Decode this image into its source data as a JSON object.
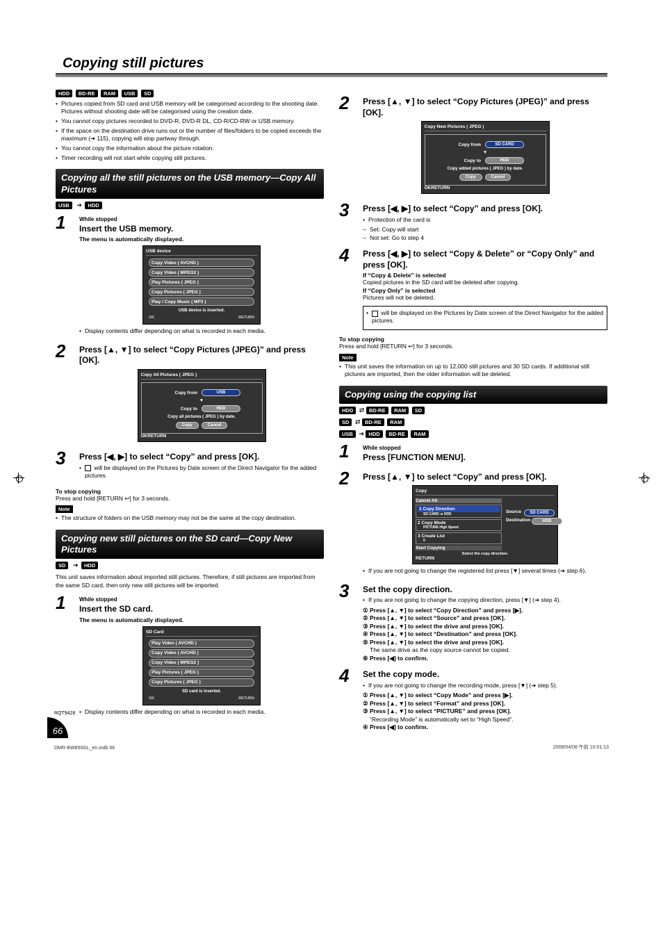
{
  "title": "Copying still pictures",
  "top_tags": [
    "HDD",
    "BD-RE",
    "RAM",
    "USB",
    "SD"
  ],
  "intro": [
    "Pictures copied from SD card and USB memory will be categorised according to the shooting date. Pictures without shooting date will be categorised using the creation date.",
    "You cannot copy pictures recorded to DVD-R, DVD-R DL, CD-R/CD-RW or USB memory.",
    "If the space on the destination drive runs out or the number of files/folders to be copied exceeds the maximum (➔ 115), copying will stop partway through.",
    "You cannot copy the information about the picture rotation.",
    "Timer recording will not start while copying still pictures."
  ],
  "sec1": {
    "head": "Copying all the still pictures on the USB memory—Copy All Pictures",
    "arrow_from": "USB",
    "arrow_to": "HDD",
    "step1_kicker": "While stopped",
    "step1_main": "Insert the USB memory.",
    "step1_sub": "The menu is automatically displayed.",
    "usb_panel": {
      "title": "USB device",
      "items": [
        "Copy Video ( AVCHD )",
        "Copy Video ( MPEG2 )",
        "Play Pictures ( JPEG )",
        "Copy Pictures ( JPEG )",
        "Play / Copy Music ( MP3 )"
      ],
      "msg": "USB device is inserted.",
      "ok": "OK",
      "ret": "RETURN"
    },
    "step1_foot": "Display contents differ depending on what is recorded in each media.",
    "step2_main": "Press [▲, ▼] to select “Copy Pictures (JPEG)” and press [OK].",
    "copyall_panel": {
      "title": "Copy All Pictures ( JPEG )",
      "from_lbl": "Copy from",
      "from_val": "USB",
      "to_lbl": "Copy to",
      "to_val": "HDD",
      "note": "Copy all pictures ( JPEG ) by date.",
      "btn1": "Copy",
      "btn2": "Cancel",
      "ok": "OK",
      "ret": "RETURN"
    },
    "step3_main": "Press [◀, ▶] to select “Copy” and press [OK].",
    "step3_foot": " will be displayed on the Pictures by Date screen of the Direct Navigator for the added pictures.",
    "stop_head": "To stop copying",
    "stop_body": "Press and hold [RETURN ↩] for 3 seconds.",
    "note_lbl": "Note",
    "note_body": "The structure of folders on the USB memory may not be the same at the copy destination."
  },
  "sec2": {
    "head": "Copying new still pictures on the SD card—Copy New Pictures",
    "arrow_from": "SD",
    "arrow_to": "HDD",
    "intro": "This unit saves information about imported still pictures. Therefore, if still pictures are imported from the same SD card, then only new still pictures will be imported.",
    "step1_kicker": "While stopped",
    "step1_main": "Insert the SD card.",
    "step1_sub": "The menu is automatically displayed.",
    "sd_panel": {
      "title": "SD Card",
      "items": [
        "Play Video ( AVCHD )",
        "Copy Video ( AVCHD )",
        "Copy Video ( MPEG2 )",
        "Play Pictures ( JPEG )",
        "Copy Pictures ( JPEG )"
      ],
      "msg": "SD card is inserted.",
      "ok": "OK",
      "ret": "RETURN"
    },
    "step1_foot": "Display contents differ depending on what is recorded in each media."
  },
  "right": {
    "step2_main": "Press [▲, ▼] to select “Copy Pictures (JPEG)” and press [OK].",
    "copynew_panel": {
      "title": "Copy New Pictures ( JPEG )",
      "from_lbl": "Copy from",
      "from_val": "SD CARD",
      "to_lbl": "Copy to",
      "to_val": "HDD",
      "note": "Copy added pictures ( JPEG ) by date.",
      "btn1": "Copy",
      "btn2": "Cancel",
      "ok": "OK",
      "ret": "RETURN"
    },
    "step3_main": "Press [◀, ▶] to select “Copy” and press [OK].",
    "step3_pro": "Protection of the card is",
    "step3_set": "Set: Copy will start",
    "step3_notset": "Not set: Go to step 4",
    "step4_main": "Press [◀, ▶] to select “Copy & Delete” or “Copy Only” and press [OK].",
    "step4_h1": "If “Copy & Delete” is selected",
    "step4_b1": "Copied pictures in the SD card will be deleted after copying.",
    "step4_h2": "If “Copy Only” is selected",
    "step4_b2": "Pictures will not be deleted.",
    "step4_foot": " will be displayed on the Pictures by Date screen of the Direct Navigator for the added pictures.",
    "stop_head": "To stop copying",
    "stop_body": "Press and hold [RETURN ↩] for 3 seconds.",
    "note_lbl": "Note",
    "note_body": "This unit saves the information on up to 12,000 still pictures and 30 SD cards. If additional still pictures are imported, then the older information will be deleted."
  },
  "sec3": {
    "head": "Copying using the copying list",
    "line1_a": "HDD",
    "line1_arr": "⇄",
    "line1_tags": [
      "BD-RE",
      "RAM",
      "SD"
    ],
    "line2_a": "SD",
    "line2_arr": "⇄",
    "line2_tags": [
      "BD-RE",
      "RAM"
    ],
    "line3_a": "USB",
    "line3_arr": "➔",
    "line3_tags": [
      "HDD",
      "BD-RE",
      "RAM"
    ],
    "step1_kicker": "While stopped",
    "step1_main": "Press [FUNCTION MENU].",
    "step2_main": "Press [▲, ▼] to select “Copy” and press [OK].",
    "copy_panel": {
      "title": "Copy",
      "cancel": "Cancel All",
      "cd_lbl": "Copy Direction",
      "cd_val": "SD CARD ➔ HDD",
      "cm_lbl": "Copy Mode",
      "cm_val": "PICTURE High Speed",
      "cl_lbl": "Create List",
      "cl_val": "0",
      "sc_lbl": "Start Copying",
      "src_lbl": "Source",
      "src_val": "SD CARD",
      "dst_lbl": "Destination",
      "dst_val": "HDD",
      "hint": "Select the copy direction.",
      "ret": "RETURN"
    },
    "step2_foot": "If you are not going to change the registered list press [▼] several times (➔ step 6).",
    "step3_main": "Set the copy direction.",
    "step3_pre": "If you are not going to change the copying direction, press [▼] (➔ step 4).",
    "step3_l1": "① Press [▲, ▼] to select “Copy Direction” and press [▶].",
    "step3_l2": "② Press [▲, ▼] to select “Source” and press [OK].",
    "step3_l3": "③ Press [▲, ▼] to select the drive and press [OK].",
    "step3_l4": "④ Press [▲, ▼] to select “Destination” and press [OK].",
    "step3_l5": "⑤ Press [▲, ▼] to select the drive and press [OK].",
    "step3_l5b": "The same drive as the copy source cannot be copied.",
    "step3_l6": "⑥ Press [◀] to confirm.",
    "step4_main": "Set the copy mode.",
    "step4_pre": "If you are not going to change the recording mode, press [▼] (➔ step 5).",
    "step4_l1": "① Press [▲, ▼] to select “Copy Mode” and press [▶].",
    "step4_l2": "② Press [▲, ▼] to select “Format” and press [OK].",
    "step4_l3": "③ Press [▲, ▼] to select “PICTURE” and press [OK].",
    "step4_l3b": "“Recording Mode” is automatically set to “High Speed”.",
    "step4_l4": "④ Press [◀] to confirm."
  },
  "page": "66",
  "rqt": "RQT9428",
  "foot_left": "DMR-BW850GL_en.indb   66",
  "foot_right": "2009/04/08   午前 10:01:13"
}
